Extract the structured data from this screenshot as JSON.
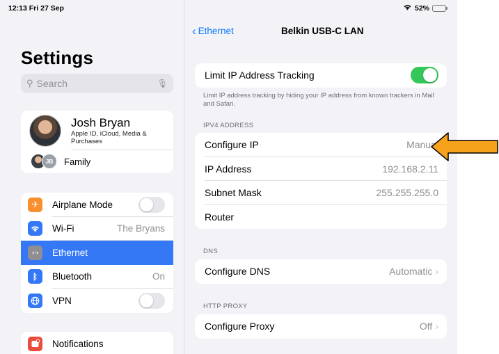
{
  "status_bar": {
    "time": "12:13  Fri 27 Sep",
    "battery": "52%",
    "battery_level": 0.52
  },
  "sidebar": {
    "title": "Settings",
    "search": {
      "placeholder": "Search"
    },
    "profile": {
      "name": "Josh Bryan",
      "subtitle": "Apple ID, iCloud, Media & Purchases",
      "family_label": "Family",
      "family_initials": "JB"
    },
    "items": [
      {
        "label": "Airplane Mode",
        "value": "",
        "icon": "airplane-icon",
        "icon_glyph": "✈",
        "color": "#f7912f",
        "toggle": false
      },
      {
        "label": "Wi-Fi",
        "value": "The Bryans",
        "icon": "wifi-icon",
        "icon_glyph": "📶",
        "color": "#3478f6"
      },
      {
        "label": "Ethernet",
        "value": "",
        "icon": "ethernet-icon",
        "icon_glyph": "‹·›",
        "color": "#8e8e93",
        "selected": true
      },
      {
        "label": "Bluetooth",
        "value": "On",
        "icon": "bluetooth-icon",
        "icon_glyph": "ᛒ",
        "color": "#3478f6"
      },
      {
        "label": "VPN",
        "value": "",
        "icon": "vpn-icon",
        "icon_glyph": "🌐",
        "color": "#3478f6",
        "toggle": false
      }
    ],
    "notifications": {
      "label": "Notifications",
      "icon": "notifications-icon",
      "color": "#eb4d3d"
    }
  },
  "detail": {
    "back_label": "Ethernet",
    "title": "Belkin USB-C LAN",
    "limit_ip": {
      "label": "Limit IP Address Tracking",
      "enabled": true,
      "footnote": "Limit IP address tracking by hiding your IP address from known trackers in Mail and Safari."
    },
    "ipv4": {
      "header": "IPV4 ADDRESS",
      "rows": [
        {
          "label": "Configure IP",
          "value": "Manual"
        },
        {
          "label": "IP Address",
          "value": "192.168.2.11"
        },
        {
          "label": "Subnet Mask",
          "value": "255.255.255.0"
        },
        {
          "label": "Router",
          "value": ""
        }
      ]
    },
    "dns": {
      "header": "DNS",
      "label": "Configure DNS",
      "value": "Automatic"
    },
    "proxy": {
      "header": "HTTP PROXY",
      "label": "Configure Proxy",
      "value": "Off"
    }
  },
  "annotation": {
    "arrow_color": "#f7a21b"
  }
}
